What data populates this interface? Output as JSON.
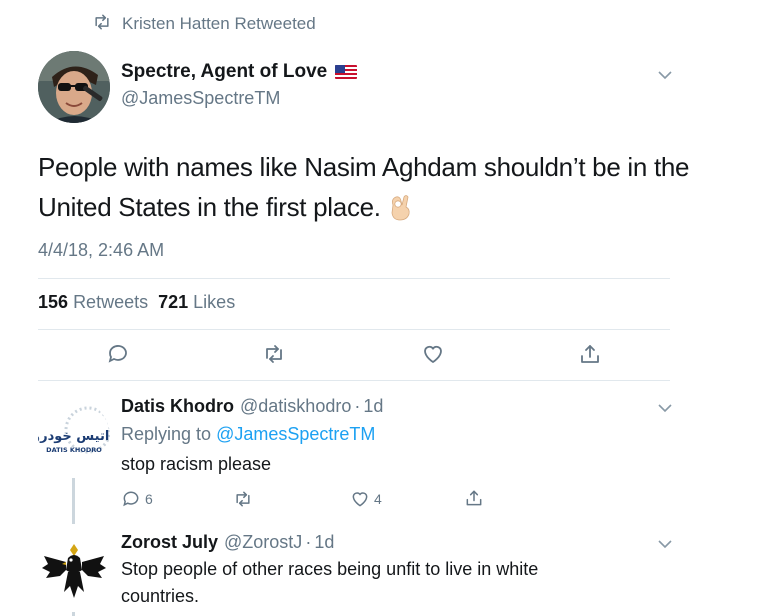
{
  "retweet_context": {
    "text": "Kristen Hatten Retweeted"
  },
  "main_tweet": {
    "author_name": "Spectre, Agent of Love",
    "author_handle": "@JamesSpectreTM",
    "text": "People with names like Nasim Aghdam shouldn’t be in the United States in the first place.",
    "emoji": "ok-hand",
    "timestamp": "4/4/18, 2:46 AM",
    "retweet_count": "156",
    "retweet_label": "Retweets",
    "like_count": "721",
    "like_label": "Likes"
  },
  "replies": [
    {
      "author_name": "Datis Khodro",
      "author_handle": "@datiskhodro",
      "sep": "·",
      "time": "1d",
      "replying_label": "Replying to",
      "replying_to": "@JamesSpectreTM",
      "text": "stop racism please",
      "reply_count": "6",
      "like_count": "4",
      "avatar_logo_text": "داتیس خودرو",
      "avatar_logo_subtext": "DATIS KHODRO"
    },
    {
      "author_name": "Zorost July",
      "author_handle": "@ZorostJ",
      "sep": "·",
      "time": "1d",
      "text_line1": "Stop people of other races being unfit to live in white",
      "text_line2": "countries."
    }
  ],
  "colors": {
    "accent": "#1da1f2",
    "secondary_text": "#657786",
    "divider": "#e1e8ed"
  }
}
